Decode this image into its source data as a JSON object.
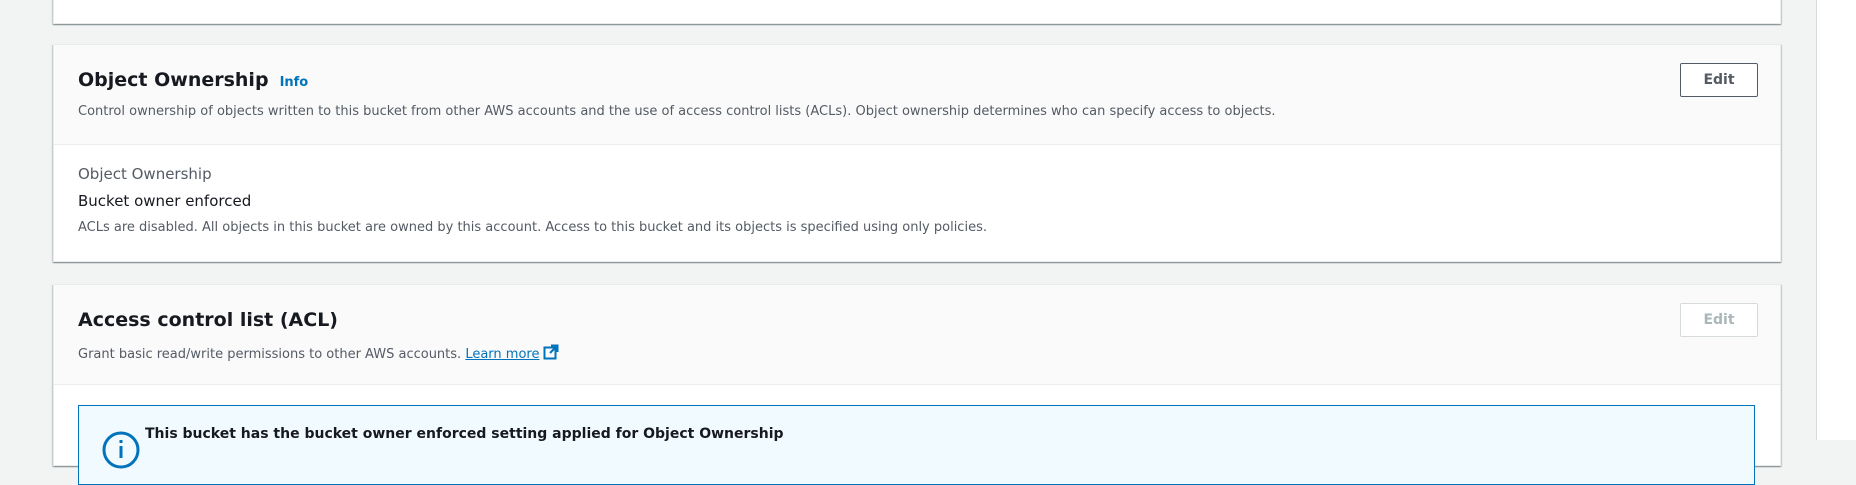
{
  "ownership": {
    "title": "Object Ownership",
    "info_label": "Info",
    "description": "Control ownership of objects written to this bucket from other AWS accounts and the use of access control lists (ACLs). Object ownership determines who can specify access to objects.",
    "edit_label": "Edit",
    "field_label": "Object Ownership",
    "field_value": "Bucket owner enforced",
    "field_description": "ACLs are disabled. All objects in this bucket are owned by this account. Access to this bucket and its objects is specified using only policies."
  },
  "acl": {
    "title": "Access control list (ACL)",
    "description": "Grant basic read/write permissions to other AWS accounts.",
    "learn_more_label": "Learn more",
    "edit_label": "Edit",
    "edit_disabled": true,
    "alert_title": "This bucket has the bucket owner enforced setting applied for Object Ownership"
  },
  "colors": {
    "link": "#0073bb",
    "text_primary": "#16191f",
    "text_secondary": "#545b64",
    "alert_border": "#0073bb",
    "alert_background": "#f1faff",
    "disabled": "#aab7b8"
  },
  "icons": {
    "external_link": "external-link-icon",
    "alert_info": "info-circle-icon"
  }
}
